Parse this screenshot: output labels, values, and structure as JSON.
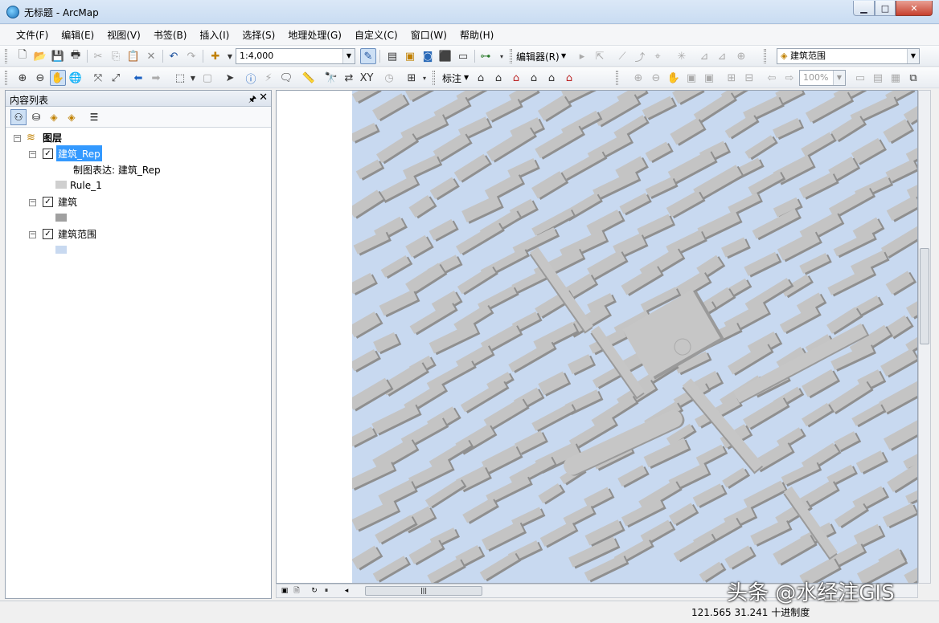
{
  "window": {
    "title": "无标题 - ArcMap",
    "minimize_icon": "minimize-icon",
    "maximize_icon": "maximize-icon",
    "close_icon": "close-icon"
  },
  "menu": [
    "文件(F)",
    "编辑(E)",
    "视图(V)",
    "书签(B)",
    "插入(I)",
    "选择(S)",
    "地理处理(G)",
    "自定义(C)",
    "窗口(W)",
    "帮助(H)"
  ],
  "toolbar": {
    "scale": "1:4,000",
    "editor_label": "编辑器(R)",
    "target_layer": "建筑范围",
    "labeling_label": "标注",
    "zoom_percent": "100%"
  },
  "toc": {
    "title": "内容列表",
    "pin_icon": "pin-icon",
    "close_icon": "close-icon",
    "root_label": "图层",
    "layers": [
      {
        "name": "建筑_Rep",
        "checked": true,
        "selected": true,
        "sub_label": "制图表达: 建筑_Rep",
        "rule_label": "Rule_1",
        "swatch": "#cfcfcf"
      },
      {
        "name": "建筑",
        "checked": true,
        "selected": false,
        "swatch": "#a0a0a0"
      },
      {
        "name": "建筑范围",
        "checked": true,
        "selected": false,
        "swatch": "#c8d9f0"
      }
    ]
  },
  "map": {
    "background": "#c8d9f0",
    "building_fill": "#c4c4c4",
    "building_shadow": "#8f8f8f"
  },
  "status": {
    "coordinates": "121.565  31.241 十进制度"
  },
  "watermark": "头条 @水经注GIS"
}
